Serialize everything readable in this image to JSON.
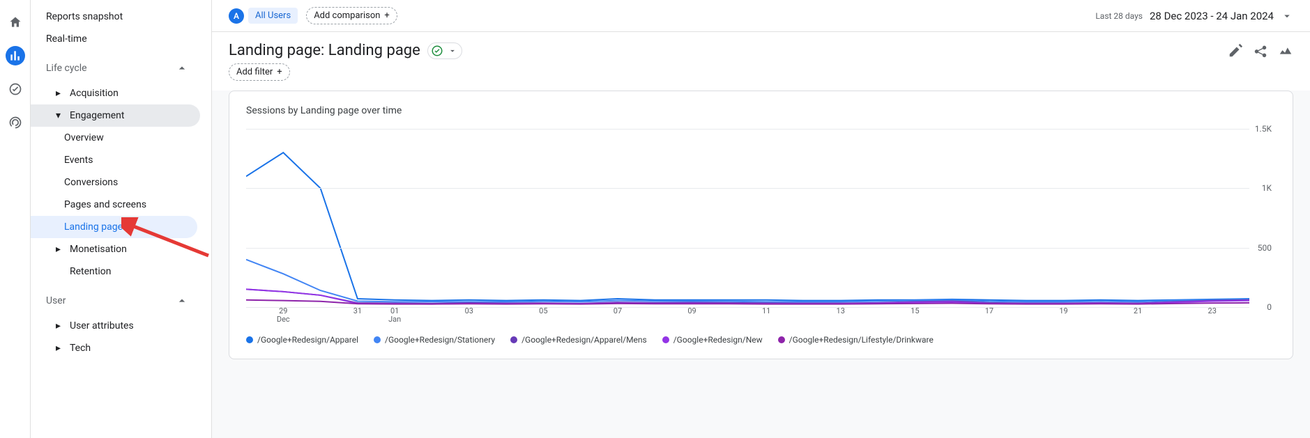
{
  "iconrail": {
    "home": "home",
    "reports": "reports",
    "explore": "explore",
    "ads": "ads"
  },
  "sidenav": {
    "reports_snapshot": "Reports snapshot",
    "realtime": "Real-time",
    "life_cycle": "Life cycle",
    "acquisition": "Acquisition",
    "engagement": "Engagement",
    "engagement_children": {
      "overview": "Overview",
      "events": "Events",
      "conversions": "Conversions",
      "pages_screens": "Pages and screens",
      "landing_page": "Landing page"
    },
    "monetisation": "Monetisation",
    "retention": "Retention",
    "user": "User",
    "user_attributes": "User attributes",
    "tech": "Tech"
  },
  "topbar": {
    "segment_badge": "A",
    "segment_label": "All Users",
    "add_comparison": "Add comparison",
    "date_label": "Last 28 days",
    "date_value": "28 Dec 2023 - 24 Jan 2024"
  },
  "page": {
    "title": "Landing page: Landing page",
    "add_filter": "Add filter"
  },
  "chart": {
    "title": "Sessions by Landing page over time"
  },
  "chart_data": {
    "type": "line",
    "title": "Sessions by Landing page over time",
    "xlabel": "",
    "ylabel": "",
    "ylim": [
      0,
      1500
    ],
    "yticks": [
      0,
      500,
      1000,
      1500
    ],
    "yticklabels": [
      "0",
      "500",
      "1K",
      "1.5K"
    ],
    "x": [
      "28 Dec",
      "29 Dec",
      "30 Dec",
      "31 Dec",
      "01 Jan",
      "02 Jan",
      "03 Jan",
      "04 Jan",
      "05 Jan",
      "06 Jan",
      "07 Jan",
      "08 Jan",
      "09 Jan",
      "10 Jan",
      "11 Jan",
      "12 Jan",
      "13 Jan",
      "14 Jan",
      "15 Jan",
      "16 Jan",
      "17 Jan",
      "18 Jan",
      "19 Jan",
      "20 Jan",
      "21 Jan",
      "22 Jan",
      "23 Jan",
      "24 Jan"
    ],
    "xticklabels": [
      {
        "top": "29",
        "sub": "Dec"
      },
      {
        "top": "31",
        "sub": ""
      },
      {
        "top": "01",
        "sub": "Jan"
      },
      {
        "top": "03",
        "sub": ""
      },
      {
        "top": "05",
        "sub": ""
      },
      {
        "top": "07",
        "sub": ""
      },
      {
        "top": "09",
        "sub": ""
      },
      {
        "top": "11",
        "sub": ""
      },
      {
        "top": "13",
        "sub": ""
      },
      {
        "top": "15",
        "sub": ""
      },
      {
        "top": "17",
        "sub": ""
      },
      {
        "top": "19",
        "sub": ""
      },
      {
        "top": "21",
        "sub": ""
      },
      {
        "top": "23",
        "sub": ""
      }
    ],
    "xtick_indices": [
      1,
      3,
      4,
      6,
      8,
      10,
      12,
      14,
      16,
      18,
      20,
      22,
      24,
      26
    ],
    "series": [
      {
        "name": "/Google+Redesign/Apparel",
        "color": "#1a73e8",
        "values": [
          1100,
          1300,
          1000,
          70,
          60,
          55,
          60,
          55,
          60,
          55,
          70,
          60,
          60,
          60,
          60,
          55,
          55,
          60,
          60,
          65,
          60,
          55,
          55,
          60,
          55,
          60,
          65,
          70
        ]
      },
      {
        "name": "/Google+Redesign/Stationery",
        "color": "#4285f4",
        "values": [
          400,
          280,
          140,
          50,
          45,
          45,
          45,
          45,
          48,
          45,
          55,
          50,
          50,
          48,
          45,
          45,
          45,
          50,
          55,
          58,
          48,
          45,
          45,
          50,
          45,
          55,
          60,
          65
        ]
      },
      {
        "name": "/Google+Redesign/Apparel/Mens",
        "color": "#673ab7",
        "values": [
          150,
          130,
          100,
          35,
          32,
          30,
          35,
          32,
          34,
          30,
          40,
          36,
          38,
          36,
          34,
          32,
          32,
          36,
          45,
          50,
          36,
          32,
          32,
          36,
          32,
          45,
          55,
          60
        ]
      },
      {
        "name": "/Google+Redesign/New",
        "color": "#9334e6",
        "values": [
          150,
          130,
          100,
          30,
          28,
          26,
          30,
          28,
          30,
          28,
          34,
          30,
          32,
          30,
          28,
          28,
          28,
          32,
          40,
          44,
          30,
          28,
          28,
          32,
          28,
          40,
          50,
          55
        ]
      },
      {
        "name": "/Google+Redesign/Lifestyle/Drinkware",
        "color": "#8e24aa",
        "values": [
          60,
          55,
          48,
          28,
          26,
          26,
          28,
          26,
          28,
          26,
          30,
          28,
          28,
          28,
          26,
          26,
          26,
          28,
          30,
          32,
          28,
          26,
          26,
          28,
          26,
          30,
          34,
          36
        ]
      }
    ]
  }
}
